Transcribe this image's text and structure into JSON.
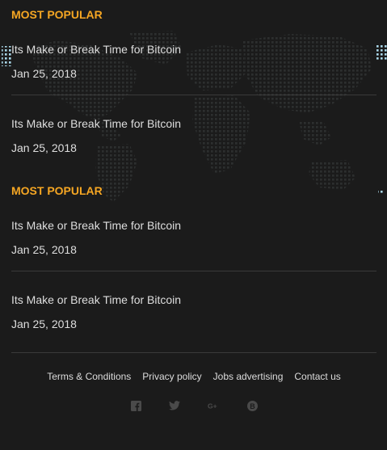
{
  "sections": [
    {
      "title": "MOST POPULAR",
      "posts": [
        {
          "title": "Its Make or Break Time for Bitcoin",
          "date": "Jan 25, 2018"
        },
        {
          "title": "Its Make or Break Time for Bitcoin",
          "date": "Jan 25, 2018"
        }
      ]
    },
    {
      "title": "MOST POPULAR",
      "posts": [
        {
          "title": "Its Make or Break Time for Bitcoin",
          "date": "Jan 25, 2018"
        },
        {
          "title": "Its Make or Break Time for Bitcoin",
          "date": "Jan 25, 2018"
        }
      ]
    }
  ],
  "footer": {
    "links": [
      "Terms & Conditions",
      "Privacy policy",
      "Jobs advertising",
      "Contact us"
    ],
    "social_icons": [
      "facebook-icon",
      "twitter-icon",
      "google-plus-icon",
      "bitcoin-icon"
    ]
  },
  "colors": {
    "background": "#1b1b1b",
    "accent": "#f5a623",
    "text": "#dedede",
    "divider": "#3a3a3a",
    "icon": "#4a4a4a",
    "map_dots": "#2e3030",
    "map_highlight": "#a9d6e8"
  }
}
